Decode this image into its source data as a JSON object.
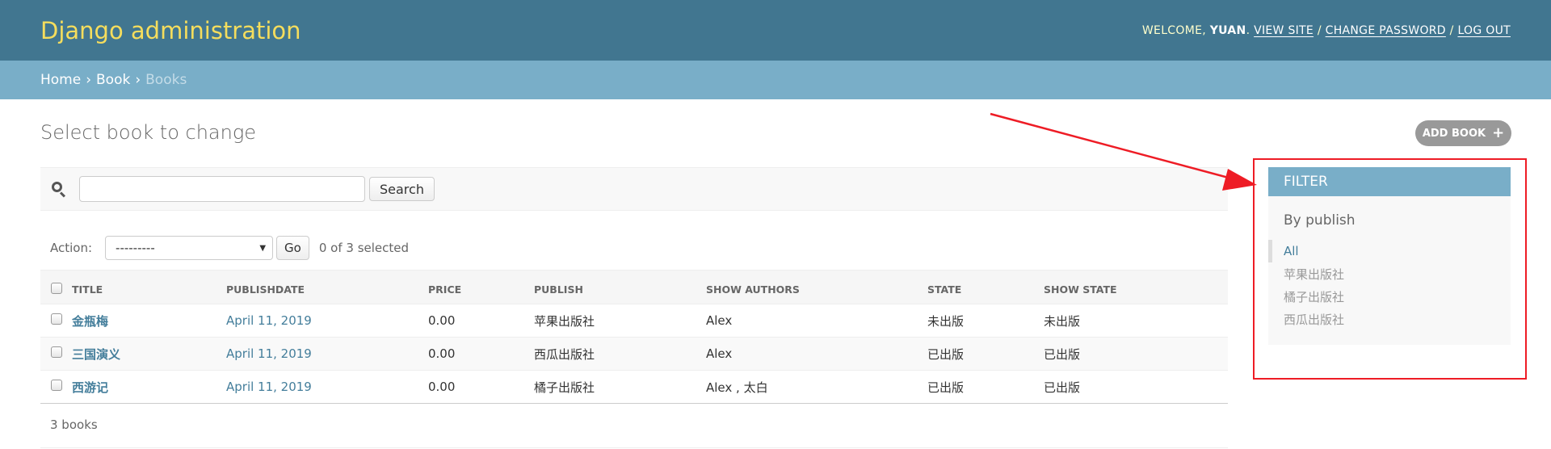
{
  "header": {
    "brand": "Django administration",
    "welcome": "WELCOME,",
    "username": "YUAN",
    "view_site": "VIEW SITE",
    "change_password": "CHANGE PASSWORD",
    "log_out": "LOG OUT",
    "sep": "/",
    "period": "."
  },
  "breadcrumbs": {
    "home": "Home",
    "app": "Book",
    "current": "Books",
    "sep": "›"
  },
  "page_title": "Select book to change",
  "add_button": "ADD BOOK",
  "search": {
    "value": "",
    "placeholder": "",
    "button": "Search"
  },
  "actions": {
    "label": "Action:",
    "selected_option": "---------",
    "go": "Go",
    "counter": "0 of 3 selected"
  },
  "table": {
    "columns": [
      "TITLE",
      "PUBLISHDATE",
      "PRICE",
      "PUBLISH",
      "SHOW AUTHORS",
      "STATE",
      "SHOW STATE"
    ],
    "rows": [
      [
        "金瓶梅",
        "April 11, 2019",
        "0.00",
        "苹果出版社",
        "Alex",
        "未出版",
        "未出版"
      ],
      [
        "三国演义",
        "April 11, 2019",
        "0.00",
        "西瓜出版社",
        "Alex",
        "已出版",
        "已出版"
      ],
      [
        "西游记",
        "April 11, 2019",
        "0.00",
        "橘子出版社",
        "Alex , 太白",
        "已出版",
        "已出版"
      ]
    ]
  },
  "result_count": "3 books",
  "filter": {
    "title": "FILTER",
    "by": "By publish",
    "options": [
      "All",
      "苹果出版社",
      "橘子出版社",
      "西瓜出版社"
    ],
    "selected": "All"
  },
  "colors": {
    "header_bg": "#417690",
    "brand": "#f5dd5d",
    "breadcrumbs_bg": "#79aec8",
    "link": "#447e9b",
    "annotation": "#ee1c25"
  }
}
